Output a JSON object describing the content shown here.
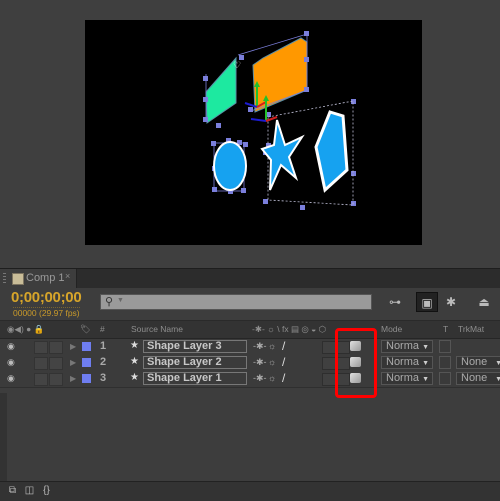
{
  "composition": {
    "tab_label": "Comp 1",
    "close_glyph": "×"
  },
  "timeline": {
    "timecode": "0;00;00;00",
    "frame_info": "00000 (29.97 fps)",
    "search_placeholder": "",
    "search_icon": "magnifier-icon",
    "toolbar": [
      {
        "name": "composition-mini-flowchart-button",
        "glyph": "⊶"
      },
      {
        "name": "draft-3d-button",
        "glyph": "▣",
        "active": true
      },
      {
        "name": "hide-shy-layers-button",
        "glyph": "✱"
      },
      {
        "name": "frame-blending-button",
        "glyph": "⏏"
      }
    ]
  },
  "columns": {
    "av_features": "◉◀) ● 🔒",
    "label": "🏷",
    "number": "#",
    "source_name": "Source Name",
    "switches": "-✱- ☼ \\ fx ▤ ◎ ◒ ⬡",
    "mode": "Mode",
    "t": "T",
    "trkmat": "TrkMat"
  },
  "layers": [
    {
      "index": "1",
      "name": "Shape Layer 3",
      "mode": "Norma",
      "trkmat": "",
      "label_color": "#6f7ef0",
      "three_d": true
    },
    {
      "index": "2",
      "name": "Shape Layer 2",
      "mode": "Norma",
      "trkmat": "None",
      "label_color": "#6f7ef0",
      "three_d": true
    },
    {
      "index": "3",
      "name": "Shape Layer 1",
      "mode": "Norma",
      "trkmat": "None",
      "label_color": "#6f7ef0",
      "three_d": true
    }
  ],
  "glyphs": {
    "eye": "◉",
    "twirl": "▶",
    "star": "★",
    "dropdown": "▼",
    "shy": "-✱-",
    "collapse": "☼",
    "quality": "/"
  },
  "bottom_bar": [
    {
      "name": "layer-switches-toggle",
      "glyph": "⧉"
    },
    {
      "name": "transfer-controls-toggle",
      "glyph": "◫"
    },
    {
      "name": "in-out-stretch-toggle",
      "glyph": "{}"
    }
  ],
  "annotation": {
    "highlight_color": "#ff0000",
    "highlighted_column": "3D Layer"
  },
  "shapes": {
    "colors": {
      "green": "#1de9a0",
      "orange": "#ff9800",
      "blue": "#16a2f0",
      "stroke": "#ffffff",
      "handle": "#7b7fdc"
    }
  }
}
